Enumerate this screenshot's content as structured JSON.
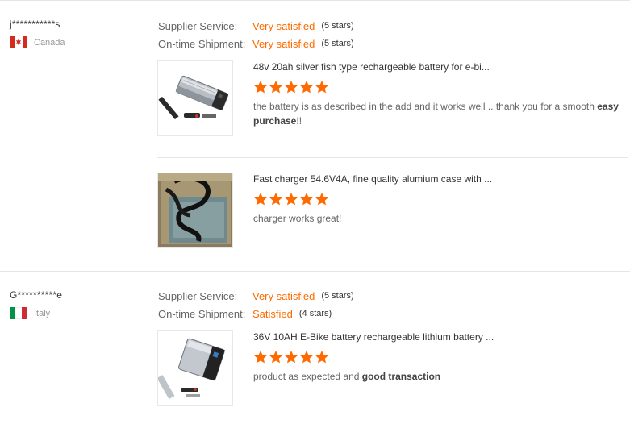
{
  "accent_color": "#ff6a00",
  "reviews": [
    {
      "buyer": "j***********s",
      "country": "Canada",
      "flag": "canada-flag-icon",
      "supplier_service": {
        "label": "Supplier Service:",
        "value": "Very satisfied",
        "stars_text": "(5 stars)"
      },
      "on_time_shipment": {
        "label": "On-time Shipment:",
        "value": "Very satisfied",
        "stars_text": "(5 stars)"
      },
      "products": [
        {
          "title": "48v 20ah silver fish type rechargeable battery for e-bi...",
          "rating": 5,
          "feedback_main": "the battery is as described in the add and it works well .. thank you for a smooth ",
          "feedback_bold": "easy purchase",
          "feedback_tail": "!!"
        },
        {
          "title": "Fast charger 54.6V4A, fine quality alumium case with ...",
          "rating": 5,
          "feedback_main": "charger works great!",
          "feedback_bold": "",
          "feedback_tail": ""
        }
      ]
    },
    {
      "buyer": "G**********e",
      "country": "Italy",
      "flag": "italy-flag-icon",
      "supplier_service": {
        "label": "Supplier Service:",
        "value": "Very satisfied",
        "stars_text": "(5 stars)"
      },
      "on_time_shipment": {
        "label": "On-time Shipment:",
        "value": "Satisfied",
        "stars_text": "(4 stars)"
      },
      "products": [
        {
          "title": "36V 10AH E-Bike battery rechargeable lithium battery ...",
          "rating": 5,
          "feedback_main": "product as expected and ",
          "feedback_bold": "good transaction",
          "feedback_tail": ""
        }
      ]
    }
  ]
}
